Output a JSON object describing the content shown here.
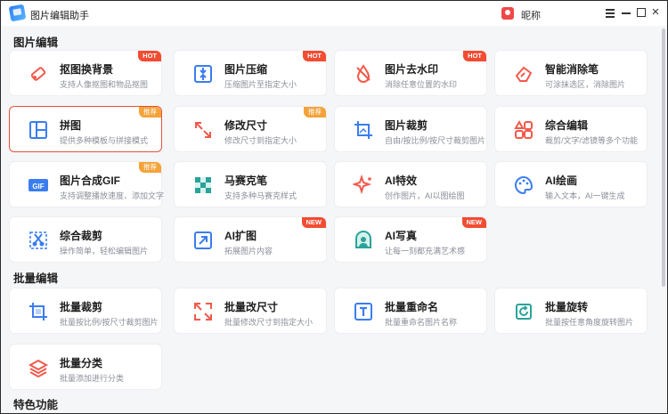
{
  "window": {
    "title": "图片编辑助手",
    "user_name": "昵称"
  },
  "colors": {
    "accent": "#3a7df0",
    "hot": "#f24c32",
    "recommend": "#f4a33a",
    "selected_border": "#e4523a"
  },
  "sections": [
    {
      "title": "图片编辑",
      "cards": [
        {
          "icon": "eraser-icon",
          "title": "抠图换背景",
          "desc": "支持人像抠图和物品抠图",
          "badge": "HOT"
        },
        {
          "icon": "compress-icon",
          "title": "图片压缩",
          "desc": "压缩图片至指定大小",
          "badge": "HOT"
        },
        {
          "icon": "watermark-drop-icon",
          "title": "图片去水印",
          "desc": "消除任意位置的水印",
          "badge": "HOT"
        },
        {
          "icon": "smart-eraser-icon",
          "title": "智能消除笔",
          "desc": "可涂抹选区，消除图片",
          "badge": ""
        },
        {
          "icon": "collage-icon",
          "title": "拼图",
          "desc": "提供多种模板与拼接模式",
          "badge": "推荐",
          "selected": true
        },
        {
          "icon": "resize-icon",
          "title": "修改尺寸",
          "desc": "修改尺寸到指定大小",
          "badge": "推荐"
        },
        {
          "icon": "crop-icon",
          "title": "图片裁剪",
          "desc": "自由/按比例/按尺寸裁剪图片",
          "badge": ""
        },
        {
          "icon": "apps-grid-icon",
          "title": "综合编辑",
          "desc": "裁剪/文字/滤镜等多个功能",
          "badge": ""
        },
        {
          "icon": "gif-icon",
          "title": "图片合成GIF",
          "desc": "支持调整播放速度、添加文字",
          "badge": "推荐"
        },
        {
          "icon": "mosaic-icon",
          "title": "马赛克笔",
          "desc": "支持多种马赛克样式",
          "badge": ""
        },
        {
          "icon": "sparkle-icon",
          "title": "AI特效",
          "desc": "创作图片，AI以图绘图",
          "badge": ""
        },
        {
          "icon": "palette-icon",
          "title": "AI绘画",
          "desc": "输入文本，AI一键生成",
          "badge": ""
        },
        {
          "icon": "scissors-icon",
          "title": "综合裁剪",
          "desc": "操作简单，轻松编辑图片",
          "badge": ""
        },
        {
          "icon": "expand-icon",
          "title": "AI扩图",
          "desc": "拓展图片内容",
          "badge": "NEW"
        },
        {
          "icon": "portrait-icon",
          "title": "AI写真",
          "desc": "让每一刻都充满艺术感",
          "badge": "NEW"
        }
      ]
    },
    {
      "title": "批量编辑",
      "cards": [
        {
          "icon": "batch-crop-icon",
          "title": "批量裁剪",
          "desc": "批量按比例/按尺寸裁剪图片",
          "badge": ""
        },
        {
          "icon": "batch-resize-icon",
          "title": "批量改尺寸",
          "desc": "批量修改尺寸到指定大小",
          "badge": ""
        },
        {
          "icon": "rename-icon",
          "title": "批量重命名",
          "desc": "批量重命名图片名称",
          "badge": ""
        },
        {
          "icon": "rotate-icon",
          "title": "批量旋转",
          "desc": "批量按任意角度旋转图片",
          "badge": ""
        },
        {
          "icon": "layers-icon",
          "title": "批量分类",
          "desc": "批量添加进行分类",
          "badge": ""
        }
      ]
    },
    {
      "title": "特色功能",
      "cards": []
    }
  ]
}
